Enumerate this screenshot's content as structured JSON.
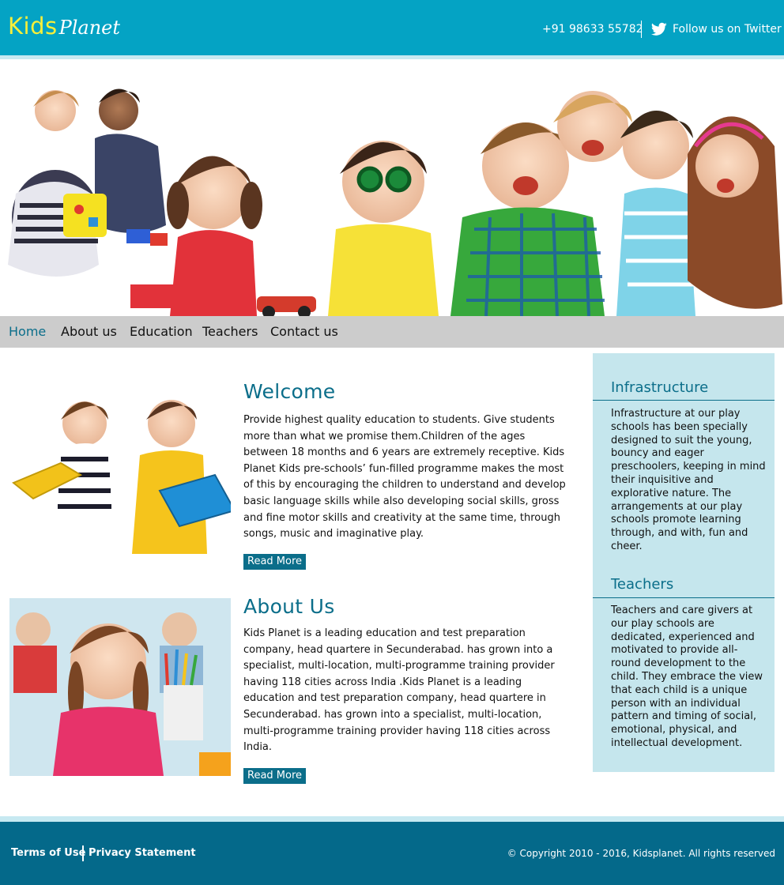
{
  "header": {
    "logo_kids": "Kids",
    "logo_planet": "Planet",
    "phone": "+91 98633 55782",
    "twitter_label": "Follow us on Twitter",
    "twitter_icon": "twitter-bird-icon"
  },
  "nav": {
    "items": [
      {
        "label": "Home",
        "active": true
      },
      {
        "label": "About us",
        "active": false
      },
      {
        "label": "Education",
        "active": false
      },
      {
        "label": "Teachers",
        "active": false
      },
      {
        "label": "Contact us",
        "active": false
      }
    ]
  },
  "articles": [
    {
      "title": "Welcome",
      "text": "Provide highest quality education to students. Give students more than what we promise them.Children of the ages between 18 months and 6 years are extremely receptive. Kids Planet Kids pre-schools’ fun-filled programme makes the most of this by encouraging the children to understand and develop basic language skills while also developing social skills, gross and fine motor skills and creativity at the same time, through songs, music and imaginative play.",
      "button": "Read More"
    },
    {
      "title": "About Us",
      "text": "Kids Planet is a leading education and test preparation company, head quartere in Secunderabad. has grown into a specialist, multi-location, multi-programme training provider having 118 cities across India .Kids Planet is a leading education and test preparation company, head quartere in Secunderabad. has grown into a specialist, multi-location, multi-programme training provider having 118 cities across India.",
      "button": "Read More"
    }
  ],
  "sidebar": {
    "sections": [
      {
        "title": "Infrastructure",
        "text": "Infrastructure at our play schools has been specially designed to suit the young, bouncy and eager preschoolers, keeping in mind their inquisitive and explorative nature. The arrangements at our play schools promote learning through, and with, fun and cheer."
      },
      {
        "title": "Teachers",
        "text": "Teachers and care givers at our play schools are dedicated, experienced and motivated to provide all-round development to the child. They embrace the view that each child is a unique person with an individual pattern and timing of social, emotional, physical, and intellectual development."
      }
    ]
  },
  "footer": {
    "terms": "Terms of Use",
    "privacy": "Privacy Statement",
    "copyright": "© Copyright 2010 - 2016, Kidsplanet. All rights reserved"
  },
  "colors": {
    "header_bg": "#04a3c4",
    "accent_dark": "#0b6e8a",
    "sidebar_bg": "#c5e6ed",
    "footer_bg": "#04698a",
    "logo_yellow": "#f7ef3a",
    "nav_bg": "#cccccc"
  }
}
